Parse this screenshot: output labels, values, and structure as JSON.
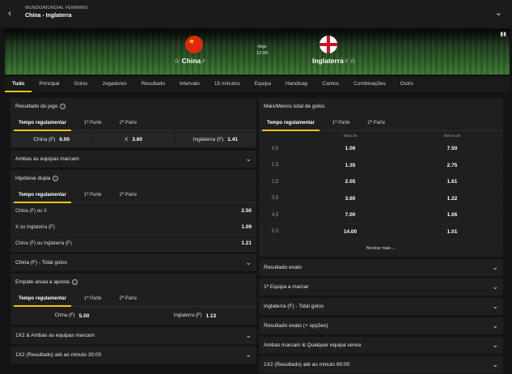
{
  "header": {
    "back_icon": "chevron-left-icon",
    "breadcrumb": "MUNDO/MUNDIAL FEMININO",
    "match": "China - Inglaterra",
    "expand_icon": "chevron-down-icon"
  },
  "hero": {
    "home": {
      "name": "China",
      "tag": "F",
      "flag": "china-flag"
    },
    "away": {
      "name": "Inglaterra",
      "tag": "F",
      "flag": "england-flag"
    },
    "day": "Hoje",
    "time": "12:00"
  },
  "tabs": [
    "Tudo",
    "Principal",
    "Golos",
    "Jogadores",
    "Resultado",
    "Intervalo",
    "15 minutos",
    "Equipa",
    "Handicap",
    "Cantos",
    "Combinações",
    "Outro"
  ],
  "left": {
    "resultado": {
      "title": "Resultado do jogo",
      "subtabs": [
        "Tempo regulamentar",
        "1ª Parte",
        "2ª Parte"
      ],
      "odds": [
        {
          "label": "China (F)",
          "value": "6.00"
        },
        {
          "label": "X",
          "value": "3.60"
        },
        {
          "label": "Inglaterra (F)",
          "value": "1.41"
        }
      ]
    },
    "ambas": {
      "title": "Ambas as equipas marcam"
    },
    "hipotese": {
      "title": "Hipótese dupla",
      "subtabs": [
        "Tempo regulamentar",
        "1ª Parte",
        "2ª Parte"
      ],
      "rows": [
        {
          "label": "China (F) ou X",
          "value": "2.50"
        },
        {
          "label": "X ou Inglaterra (F)",
          "value": "1.09"
        },
        {
          "label": "China (F) ou Inglaterra (F)",
          "value": "1.21"
        }
      ]
    },
    "china_total": {
      "title": "China (F) - Total golos"
    },
    "empate": {
      "title": "Empate anula a aposta",
      "subtabs": [
        "Tempo regulamentar",
        "1ª Parte",
        "2ª Parte"
      ],
      "odds": [
        {
          "label": "China (F)",
          "value": "5.00"
        },
        {
          "label": "Inglaterra (F)",
          "value": "1.13"
        }
      ]
    },
    "collapsed": [
      "1X2 & Ambas as equipas marcam",
      "1X2 (Resultado) até ao minuto 30:00"
    ]
  },
  "right": {
    "ou": {
      "title": "Mais/Menos total de golos",
      "subtabs": [
        "Tempo regulamentar",
        "1ª Parte",
        "2ª Parte"
      ],
      "col_over": "Mais de",
      "col_under": "Menos de",
      "rows": [
        {
          "line": "0,5",
          "over": "1.06",
          "under": "7.50"
        },
        {
          "line": "1,5",
          "over": "1.35",
          "under": "2.75"
        },
        {
          "line": "2,5",
          "over": "2.05",
          "under": "1.61"
        },
        {
          "line": "3,5",
          "over": "3.60",
          "under": "1.22"
        },
        {
          "line": "4,5",
          "over": "7.00",
          "under": "1.06"
        },
        {
          "line": "5,5",
          "over": "14.00",
          "under": "1.01"
        }
      ],
      "show_more": "Mostrar mais"
    },
    "collapsed": [
      "Resultado exato",
      "1ª Equipa a marcar",
      "Inglaterra (F) - Total golos",
      "Resultado exato (+ opções)",
      "Ambas marcam & Qualquer equipa vence",
      "1X2 (Resultado) até ao minuto 60:00"
    ]
  },
  "colors": {
    "accent": "#f5c518",
    "panel": "#1f1f1f",
    "background": "#141414"
  }
}
